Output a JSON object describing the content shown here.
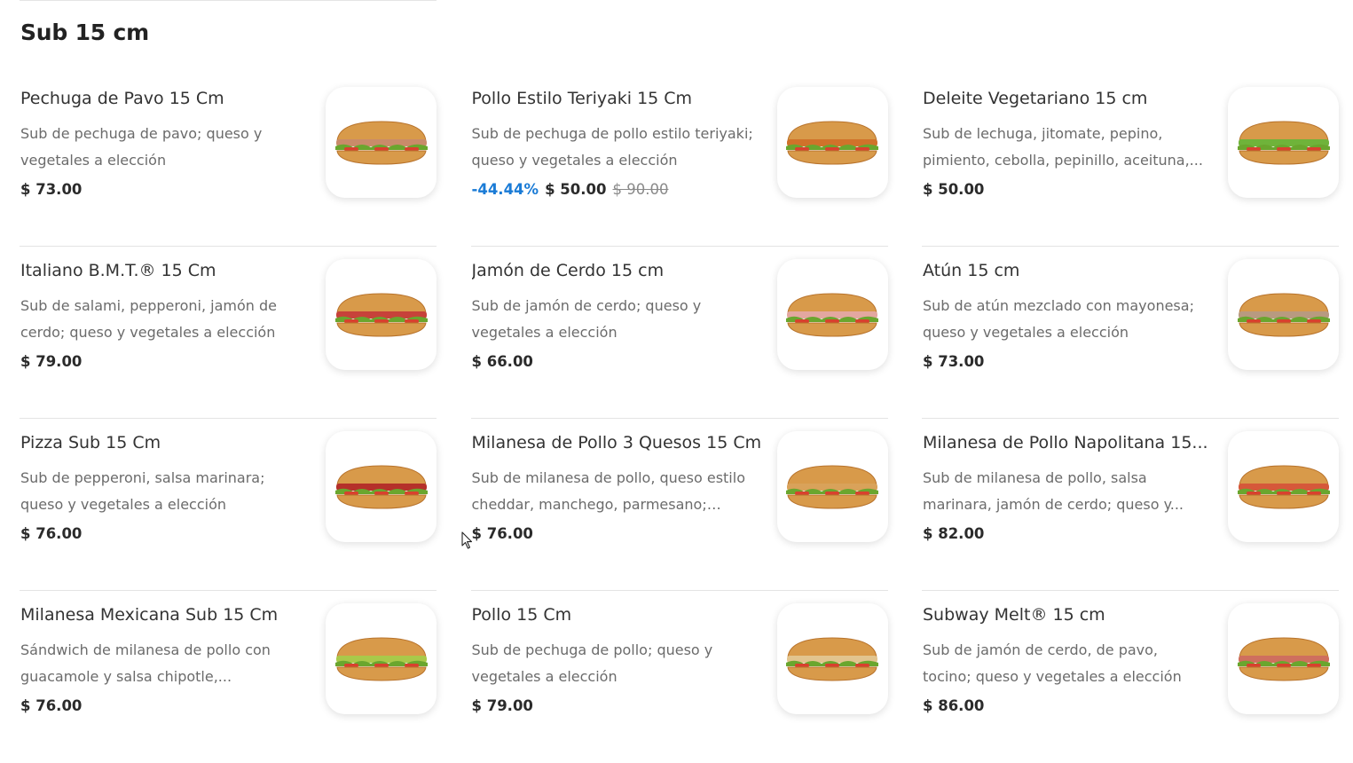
{
  "section": {
    "title": "Sub 15 cm"
  },
  "products": [
    {
      "name": "Pechuga de Pavo 15 Cm",
      "description": "Sub de pechuga de pavo; queso y vegetales a elección",
      "price": "$ 73.00",
      "discount": "",
      "old_price": "",
      "image": "sandwich-turkey",
      "filling": "#c98b6a"
    },
    {
      "name": "Pollo Estilo Teriyaki 15 Cm",
      "description": "Sub de pechuga de pollo estilo teriyaki; queso y vegetales a elección",
      "price": "$ 50.00",
      "discount": "-44.44%",
      "old_price": "$ 90.00",
      "image": "sandwich-teriyaki-chicken",
      "filling": "#d0722a"
    },
    {
      "name": "Deleite Vegetariano 15 cm",
      "description": "Sub de lechuga, jitomate, pepino, pimiento, cebolla, pepinillo, aceituna,...",
      "price": "$ 50.00",
      "discount": "",
      "old_price": "",
      "image": "sandwich-veggie",
      "filling": "#6fb33a"
    },
    {
      "name": "Italiano B.M.T.® 15 Cm",
      "description": "Sub de salami, pepperoni, jamón de cerdo; queso y vegetales a elección",
      "price": "$ 79.00",
      "discount": "",
      "old_price": "",
      "image": "sandwich-italian-bmt",
      "filling": "#c7423a"
    },
    {
      "name": "Jamón de Cerdo 15 cm",
      "description": "Sub de jamón de cerdo; queso y vegetales a elección",
      "price": "$ 66.00",
      "discount": "",
      "old_price": "",
      "image": "sandwich-ham",
      "filling": "#e3a7a0"
    },
    {
      "name": "Atún 15 cm",
      "description": "Sub de atún mezclado con mayonesa; queso y vegetales a elección",
      "price": "$ 73.00",
      "discount": "",
      "old_price": "",
      "image": "sandwich-tuna",
      "filling": "#b89a80"
    },
    {
      "name": "Pizza Sub 15 Cm",
      "description": "Sub de pepperoni, salsa marinara; queso y vegetales a elección",
      "price": "$ 76.00",
      "discount": "",
      "old_price": "",
      "image": "sandwich-pizza",
      "filling": "#b5302a"
    },
    {
      "name": "Milanesa de Pollo 3 Quesos 15 Cm",
      "description": "Sub de milanesa de pollo, queso estilo cheddar, manchego, parmesano; queso...",
      "price": "$ 76.00",
      "discount": "",
      "old_price": "",
      "image": "sandwich-chicken-three-cheese",
      "filling": "#d9a25a"
    },
    {
      "name": "Milanesa de Pollo Napolitana 15...",
      "description": "Sub de milanesa de pollo, salsa marinara, jamón de cerdo; queso y...",
      "price": "$ 82.00",
      "discount": "",
      "old_price": "",
      "image": "sandwich-chicken-napolitana",
      "filling": "#d6583a"
    },
    {
      "name": "Milanesa Mexicana Sub 15 Cm",
      "description": "Sándwich de milanesa de pollo con guacamole y salsa chipotle,...",
      "price": "$ 76.00",
      "discount": "",
      "old_price": "",
      "image": "sandwich-chicken-mexicana",
      "filling": "#a9c94a"
    },
    {
      "name": "Pollo 15 Cm",
      "description": "Sub de pechuga de pollo; queso y vegetales a elección",
      "price": "$ 79.00",
      "discount": "",
      "old_price": "",
      "image": "sandwich-chicken",
      "filling": "#e2c48e"
    },
    {
      "name": "Subway Melt® 15 cm",
      "description": "Sub de jamón de cerdo, de pavo, tocino; queso y vegetales a elección",
      "price": "$ 86.00",
      "discount": "",
      "old_price": "",
      "image": "sandwich-subway-melt",
      "filling": "#cf6f5e"
    }
  ],
  "colors": {
    "discount": "#1a7bd6",
    "bread": "#d89a4a",
    "bread_dark": "#b8732c",
    "lettuce": "#6aa62e",
    "tomato": "#d8412e"
  }
}
